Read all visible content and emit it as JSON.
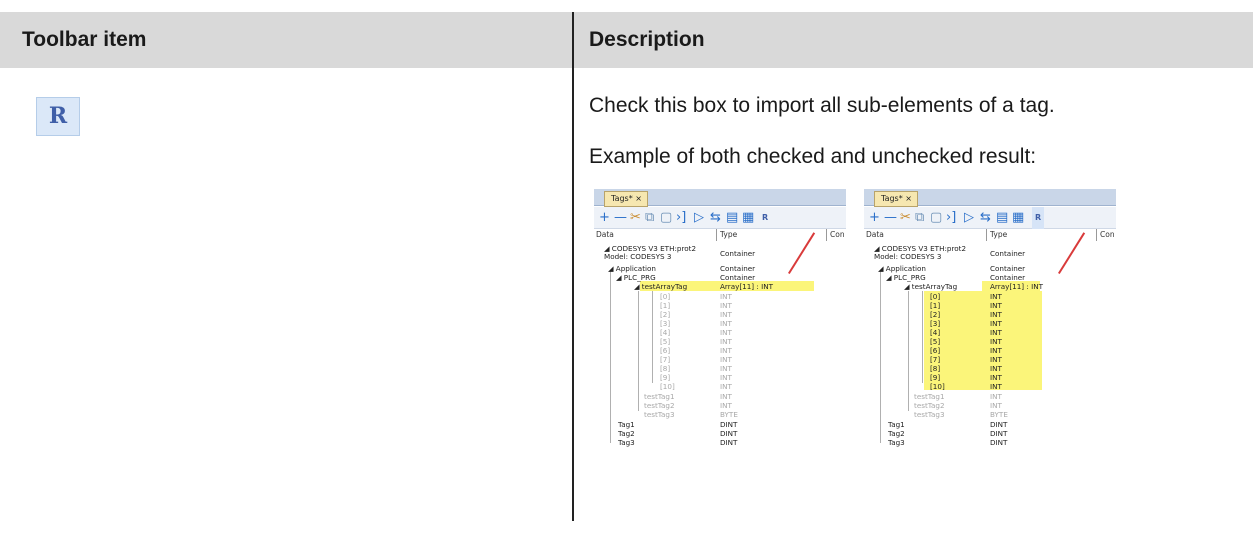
{
  "table": {
    "header": {
      "col1": "Toolbar item",
      "col2": "Description"
    },
    "row": {
      "icon_glyph": "R",
      "icon_name": "import-sub-elements-icon",
      "description_line1": "Check this box to import all sub-elements of a tag.",
      "description_line2": "Example of both checked and unchecked result:"
    }
  },
  "screenshots": {
    "tab_label": "Tags*",
    "tab_close": "×",
    "toolbar_glyphs": [
      "+",
      "—",
      "✂",
      "⧉",
      "▢",
      "›]",
      "▷",
      "⇆",
      "▤",
      "▦",
      "R"
    ],
    "col_data": "Data",
    "col_type": "Type",
    "col_con": "Con",
    "rows": [
      {
        "name": "CODESYS V3 ETH:prot2",
        "type": ""
      },
      {
        "name": "Model: CODESYS 3",
        "type": "Container"
      },
      {
        "name": "Application",
        "type": "Container"
      },
      {
        "name": "PLC_PRG",
        "type": "Container"
      },
      {
        "name": "testArrayTag",
        "type": "Array[11] : INT"
      },
      {
        "name": "[0]",
        "type": "INT"
      },
      {
        "name": "[1]",
        "type": "INT"
      },
      {
        "name": "[2]",
        "type": "INT"
      },
      {
        "name": "[3]",
        "type": "INT"
      },
      {
        "name": "[4]",
        "type": "INT"
      },
      {
        "name": "[5]",
        "type": "INT"
      },
      {
        "name": "[6]",
        "type": "INT"
      },
      {
        "name": "[7]",
        "type": "INT"
      },
      {
        "name": "[8]",
        "type": "INT"
      },
      {
        "name": "[9]",
        "type": "INT"
      },
      {
        "name": "[10]",
        "type": "INT"
      },
      {
        "name": "testTag1",
        "type": "INT"
      },
      {
        "name": "testTag2",
        "type": "INT"
      },
      {
        "name": "testTag3",
        "type": "BYTE"
      },
      {
        "name": "Tag1",
        "type": "DINT"
      },
      {
        "name": "Tag2",
        "type": "DINT"
      },
      {
        "name": "Tag3",
        "type": "DINT"
      }
    ]
  }
}
